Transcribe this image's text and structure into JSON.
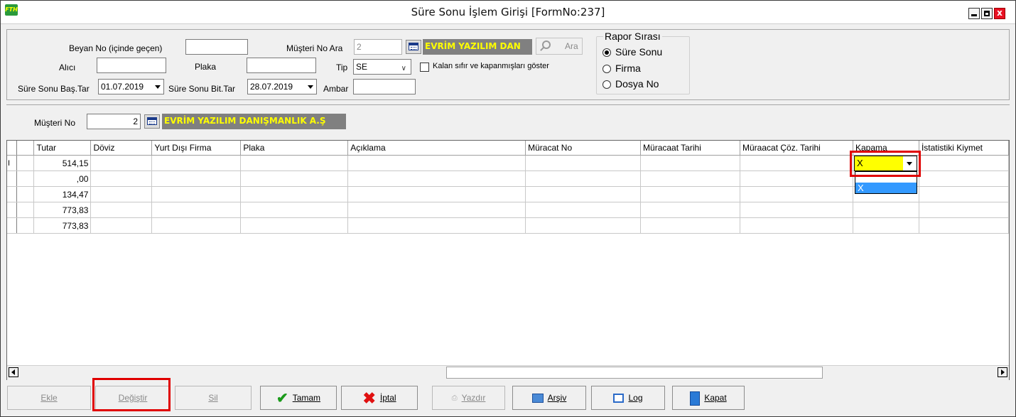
{
  "window": {
    "title": "Süre Sonu İşlem Girişi [FormNo:237]",
    "app_icon_text": "FTH",
    "close_glyph": "x"
  },
  "filters": {
    "beyan_no_label": "Beyan No (içinde geçen)",
    "beyan_no_value": "",
    "alici_label": "Alıcı",
    "alici_value": "",
    "plaka_label": "Plaka",
    "plaka_value": "",
    "sure_sonu_bas_label": "Süre Sonu Baş.Tar",
    "sure_sonu_bas_value": "01.07.2019",
    "sure_sonu_bit_label": "Süre Sonu Bit.Tar",
    "sure_sonu_bit_value": "28.07.2019",
    "musteri_no_ara_label": "Müşteri No Ara",
    "musteri_no_ara_value": "2",
    "musteri_name_value": "EVRİM YAZILIM DAN",
    "ara_button": "Ara",
    "tip_label": "Tip",
    "tip_value": "SE",
    "kalan_label": "Kalan sıfır ve kapanmışları göster",
    "ambar_label": "Ambar",
    "ambar_value": ""
  },
  "rapor_sirasi": {
    "label": "Rapor Sırası",
    "options": [
      "Süre Sonu",
      "Firma",
      "Dosya No"
    ],
    "selected": "Süre Sonu"
  },
  "musteri": {
    "label": "Müşteri No",
    "value": "2",
    "name": "EVRİM YAZILIM DANIŞMANLIK A.Ş"
  },
  "grid": {
    "columns": [
      "Tutar",
      "Döviz",
      "Yurt Dışı Firma",
      "Plaka",
      "Açıklama",
      "Müracat No",
      "Müracaat Tarihi",
      "Müraacat Çöz. Tarihi",
      "Kapama",
      "İstatistiki Kiymet"
    ],
    "rows": [
      {
        "indicator": "I",
        "tutar": "514,15"
      },
      {
        "indicator": "",
        "tutar": ",00"
      },
      {
        "indicator": "",
        "tutar": "134,47"
      },
      {
        "indicator": "",
        "tutar": "773,83"
      },
      {
        "indicator": "",
        "tutar": "773,83"
      }
    ],
    "kapama_value": "X",
    "kapama_options": [
      "",
      "X"
    ]
  },
  "buttons": {
    "ekle": "Ekle",
    "degistir": "Değiştir",
    "sil": "Sil",
    "tamam": "Tamam",
    "iptal": "İptal",
    "yazdir": "Yazdır",
    "arsiv": "Arşiv",
    "log": "Log",
    "kapat": "Kapat"
  },
  "colors": {
    "highlight_yellow": "#ffff00",
    "name_bg": "#808080",
    "annotation_red": "#e00000",
    "selection_blue": "#3399ff"
  }
}
